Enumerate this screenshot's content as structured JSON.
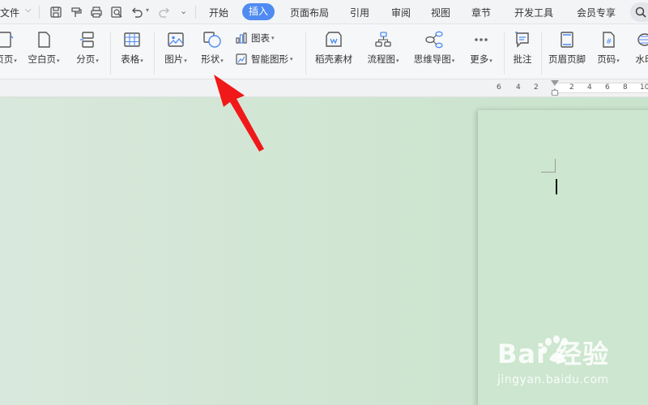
{
  "menubar": {
    "file_label": "文件",
    "tabs": [
      {
        "label": "开始"
      },
      {
        "label": "插入"
      },
      {
        "label": "页面布局"
      },
      {
        "label": "引用"
      },
      {
        "label": "审阅"
      },
      {
        "label": "视图"
      },
      {
        "label": "章节"
      },
      {
        "label": "开发工具"
      },
      {
        "label": "会员专享"
      }
    ],
    "active_tab": "插入"
  },
  "ribbon": {
    "cover_page": "页页",
    "blank_page": "空白页",
    "page_break": "分页",
    "table": "表格",
    "picture": "图片",
    "shape": "形状",
    "chart": "图表",
    "smart_art": "智能图形",
    "stock_material": "稻壳素材",
    "flowchart": "流程图",
    "mind_map": "思维导图",
    "more": "更多",
    "comment": "批注",
    "header_footer": "页眉页脚",
    "page_number": "页码",
    "watermark": "水印"
  },
  "ruler": {
    "left_ticks": [
      "6",
      "4",
      "2"
    ],
    "right_ticks": [
      "2",
      "4",
      "6",
      "8",
      "10"
    ]
  },
  "watermark": {
    "brand": "Bai  经验",
    "url": "jingyan.baidu.com"
  },
  "colors": {
    "accent": "#4f8bf2",
    "arrow": "#f01818",
    "workspace": "#cfe5d1"
  }
}
